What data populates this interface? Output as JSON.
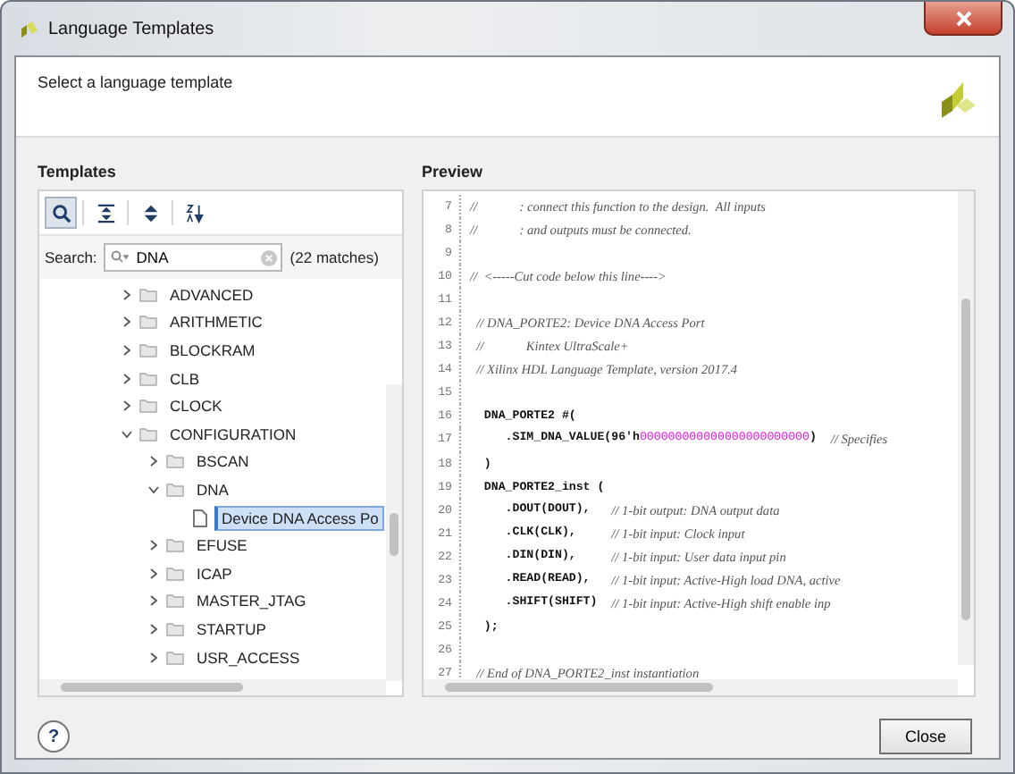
{
  "window": {
    "title": "Language Templates"
  },
  "header": {
    "subtitle": "Select a language template"
  },
  "templates": {
    "title": "Templates",
    "toolbar": [
      {
        "kind": "search",
        "selected": true
      },
      {
        "kind": "collapse",
        "selected": false
      },
      {
        "kind": "expand",
        "selected": false
      },
      {
        "kind": "sort",
        "selected": false
      }
    ],
    "search": {
      "label": "Search:",
      "value": "DNA",
      "matches": "(22 matches)"
    },
    "tree": [
      {
        "label": "ADVANCED",
        "expanded": false
      },
      {
        "label": "ARITHMETIC",
        "expanded": false
      },
      {
        "label": "BLOCKRAM",
        "expanded": false
      },
      {
        "label": "CLB",
        "expanded": false
      },
      {
        "label": "CLOCK",
        "expanded": false
      },
      {
        "label": "CONFIGURATION",
        "expanded": true,
        "children": [
          {
            "label": "BSCAN",
            "expanded": false
          },
          {
            "label": "DNA",
            "expanded": true,
            "children": [
              {
                "label": "Device DNA Access Po",
                "kind": "file",
                "selected": true
              }
            ]
          },
          {
            "label": "EFUSE",
            "expanded": false
          },
          {
            "label": "ICAP",
            "expanded": false
          },
          {
            "label": "MASTER_JTAG",
            "expanded": false
          },
          {
            "label": "STARTUP",
            "expanded": false
          },
          {
            "label": "USR_ACCESS",
            "expanded": false
          }
        ]
      }
    ]
  },
  "preview": {
    "title": "Preview",
    "lines": [
      {
        "number": "7",
        "segments": [
          {
            "kind": "comment",
            "text": "//             : connect this function to the design.  All inputs"
          }
        ]
      },
      {
        "number": "8",
        "segments": [
          {
            "kind": "comment",
            "text": "//             : and outputs must be connected."
          }
        ]
      },
      {
        "number": "9"
      },
      {
        "number": "10",
        "segments": [
          {
            "kind": "comment",
            "text": "//  <-----Cut code below this line---->"
          }
        ]
      },
      {
        "number": "11"
      },
      {
        "number": "12",
        "segments": [
          {
            "kind": "comment",
            "text": "  // DNA_PORTE2: Device DNA Access Port"
          }
        ]
      },
      {
        "number": "13",
        "segments": [
          {
            "kind": "comment",
            "text": "  //             Kintex UltraScale+"
          }
        ]
      },
      {
        "number": "14",
        "segments": [
          {
            "kind": "comment",
            "text": "  // Xilinx HDL Language Template, version 2017.4"
          }
        ]
      },
      {
        "number": "15"
      },
      {
        "number": "16",
        "segments": [
          {
            "kind": "code",
            "text": "  DNA_PORTE2 #("
          }
        ]
      },
      {
        "number": "17",
        "segments": [
          {
            "kind": "code",
            "text": "     .SIM_DNA_VALUE(96'h"
          },
          {
            "kind": "literal",
            "text": "000000000000000000000000"
          },
          {
            "kind": "code",
            "text": ")  "
          },
          {
            "kind": "comment",
            "text": "// Specifies"
          }
        ]
      },
      {
        "number": "18",
        "segments": [
          {
            "kind": "code",
            "text": "  )"
          }
        ]
      },
      {
        "number": "19",
        "segments": [
          {
            "kind": "code",
            "text": "  DNA_PORTE2_inst ("
          }
        ]
      },
      {
        "number": "20",
        "segments": [
          {
            "kind": "code",
            "text": "     .DOUT(DOUT),   "
          },
          {
            "kind": "comment",
            "text": "// 1-bit output: DNA output data"
          }
        ]
      },
      {
        "number": "21",
        "segments": [
          {
            "kind": "code",
            "text": "     .CLK(CLK),     "
          },
          {
            "kind": "comment",
            "text": "// 1-bit input: Clock input"
          }
        ]
      },
      {
        "number": "22",
        "segments": [
          {
            "kind": "code",
            "text": "     .DIN(DIN),     "
          },
          {
            "kind": "comment",
            "text": "// 1-bit input: User data input pin"
          }
        ]
      },
      {
        "number": "23",
        "segments": [
          {
            "kind": "code",
            "text": "     .READ(READ),   "
          },
          {
            "kind": "comment",
            "text": "// 1-bit input: Active-High load DNA, active"
          }
        ]
      },
      {
        "number": "24",
        "segments": [
          {
            "kind": "code",
            "text": "     .SHIFT(SHIFT)  "
          },
          {
            "kind": "comment",
            "text": "// 1-bit input: Active-High shift enable inp"
          }
        ]
      },
      {
        "number": "25",
        "segments": [
          {
            "kind": "code",
            "text": "  );"
          }
        ]
      },
      {
        "number": "26"
      },
      {
        "number": "27",
        "segments": [
          {
            "kind": "comment",
            "text": "  // End of DNA_PORTE2_inst instantiation"
          }
        ]
      }
    ]
  },
  "footer": {
    "help": "?",
    "close": "Close"
  }
}
